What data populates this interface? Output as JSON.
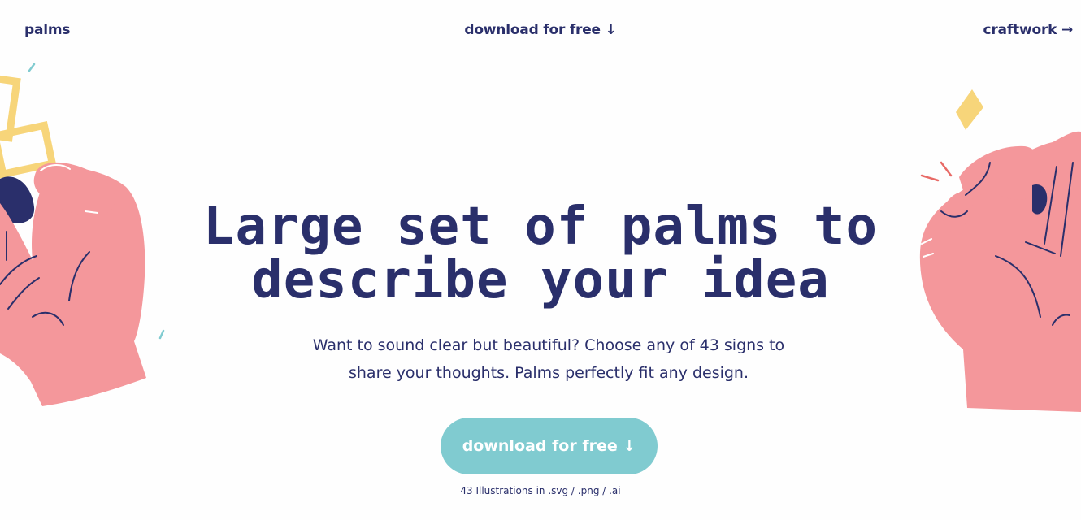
{
  "nav": {
    "logo": "palms",
    "download": "download for free ↓",
    "craftwork": "craftwork →"
  },
  "hero": {
    "title_line1": "Large set of palms to",
    "title_line2": "describe your idea",
    "subtitle_line1": "Want to sound clear but beautiful? Choose any of 43 signs to",
    "subtitle_line2": "share your thoughts. Palms perfectly fit any design.",
    "cta": "download for free ↓",
    "formats": "43 Illustrations in .svg / .png / .ai"
  },
  "colors": {
    "navy": "#2a2f6b",
    "teal": "#80cbd0",
    "pink": "#f4979b",
    "yellow": "#f7d57a"
  },
  "icons": {
    "left": "hand-holding-chain-illustration",
    "right": "hand-ok-sign-illustration"
  }
}
